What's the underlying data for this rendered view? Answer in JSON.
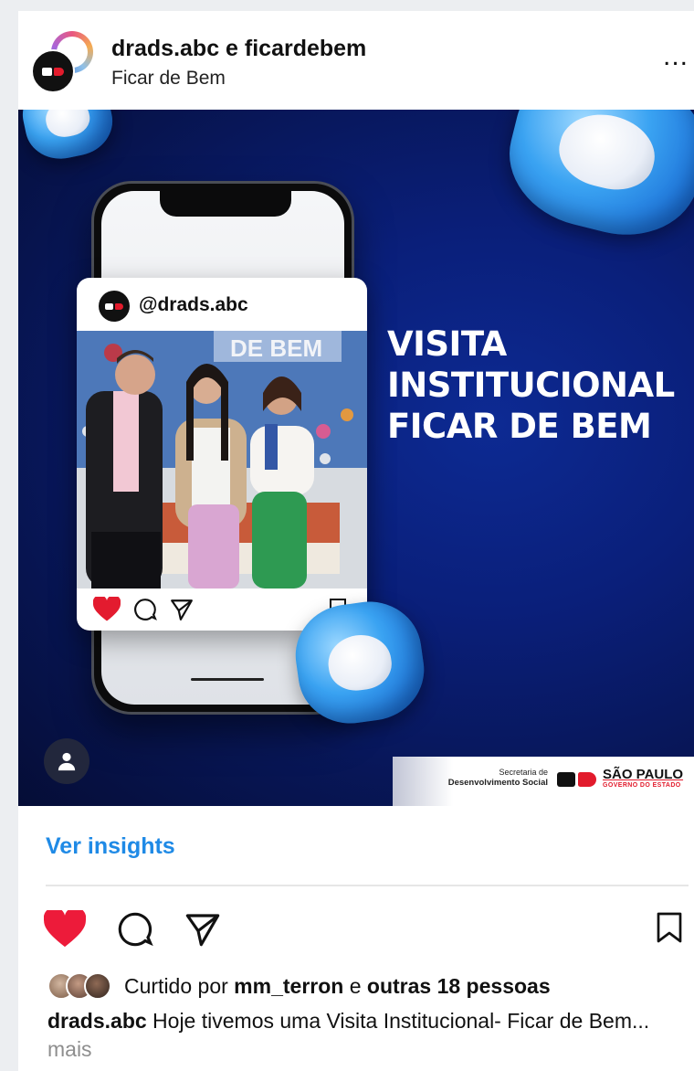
{
  "post": {
    "author_line": "drads.abc e ficardebem",
    "subtitle": "Ficar de Bem",
    "more_label": "..."
  },
  "media": {
    "inner_post_handle": "@drads.abc",
    "inner_photo_sign": "DE BEM",
    "headline_lines": [
      "VISITA",
      "INSTITUCIONAL",
      "FICAR DE BEM"
    ],
    "gov": {
      "secretaria_line1": "Secretaria de",
      "secretaria_line2": "Desenvolvimento Social",
      "state_name": "SÃO PAULO",
      "state_sub": "GOVERNO DO ESTADO"
    }
  },
  "insights_label": "Ver insights",
  "likes": {
    "prefix": "Curtido por",
    "user": "mm_terron",
    "joiner": "e",
    "others": "outras 18 pessoas"
  },
  "caption": {
    "author": "drads.abc",
    "text": "Hoje tivemos uma Visita Institucional- Ficar de Bem...",
    "more": "mais"
  },
  "colors": {
    "like_red": "#ed1b3a",
    "link_blue": "#1f8ae6",
    "media_navy": "#0a1f7a"
  }
}
